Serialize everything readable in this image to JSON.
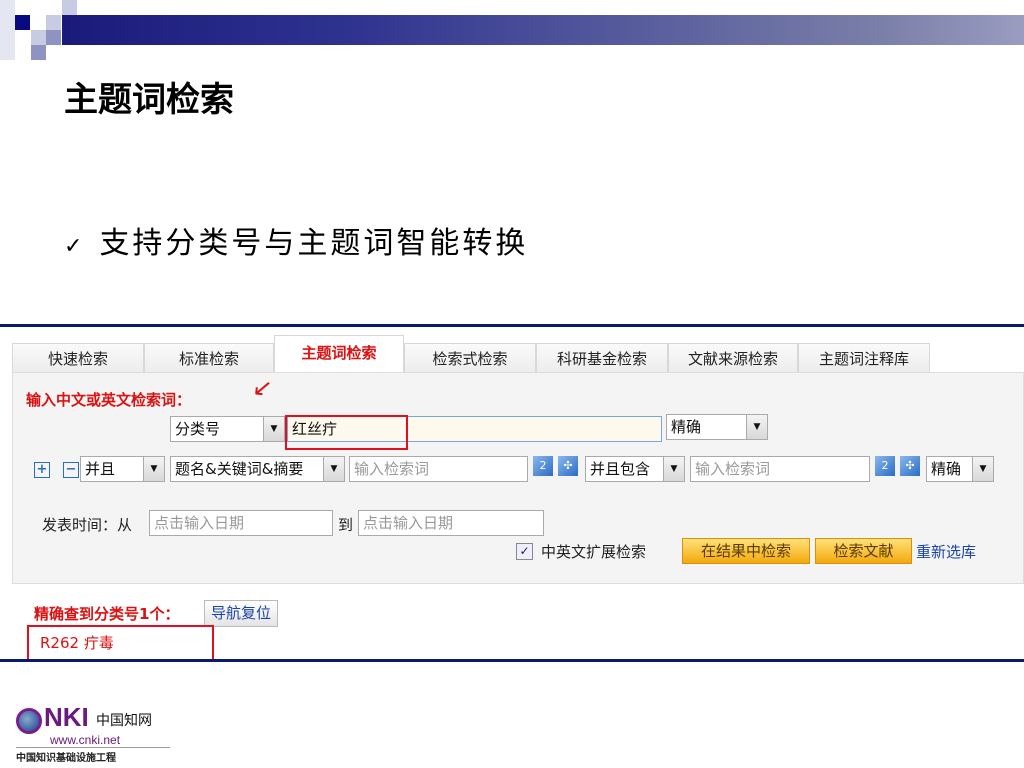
{
  "slide": {
    "title": "主题词检索",
    "bullet": "支持分类号与主题词智能转换"
  },
  "tabs": [
    "快速检索",
    "标准检索",
    "主题词检索",
    "检索式检索",
    "科研基金检索",
    "文献来源检索",
    "主题词注释库"
  ],
  "form": {
    "prompt": "输入中文或英文检索词：",
    "field_select": "分类号",
    "main_input": "红丝疔",
    "match_select": "精确",
    "row2": {
      "logic": "并且",
      "field": "题名&关键词&摘要",
      "input1_placeholder": "输入检索词",
      "contain": "并且包含",
      "input2_placeholder": "输入检索词",
      "match": "精确"
    },
    "date_label": "发表时间：从",
    "date_from_placeholder": "点击输入日期",
    "date_to": "到",
    "date_to_placeholder": "点击输入日期",
    "expand_label": "中英文扩展检索",
    "expand_checked": true,
    "search_in_results": "在结果中检索",
    "search_docs": "检索文献",
    "reselect": "重新选库"
  },
  "result": {
    "summary": "精确查到分类号1个：",
    "reset": "导航复位",
    "item": "R262 疔毒"
  },
  "logo": {
    "brand": "CNKI中国知网",
    "url": "www.cnki.net",
    "tagline": "中国知识基础设施工程"
  }
}
